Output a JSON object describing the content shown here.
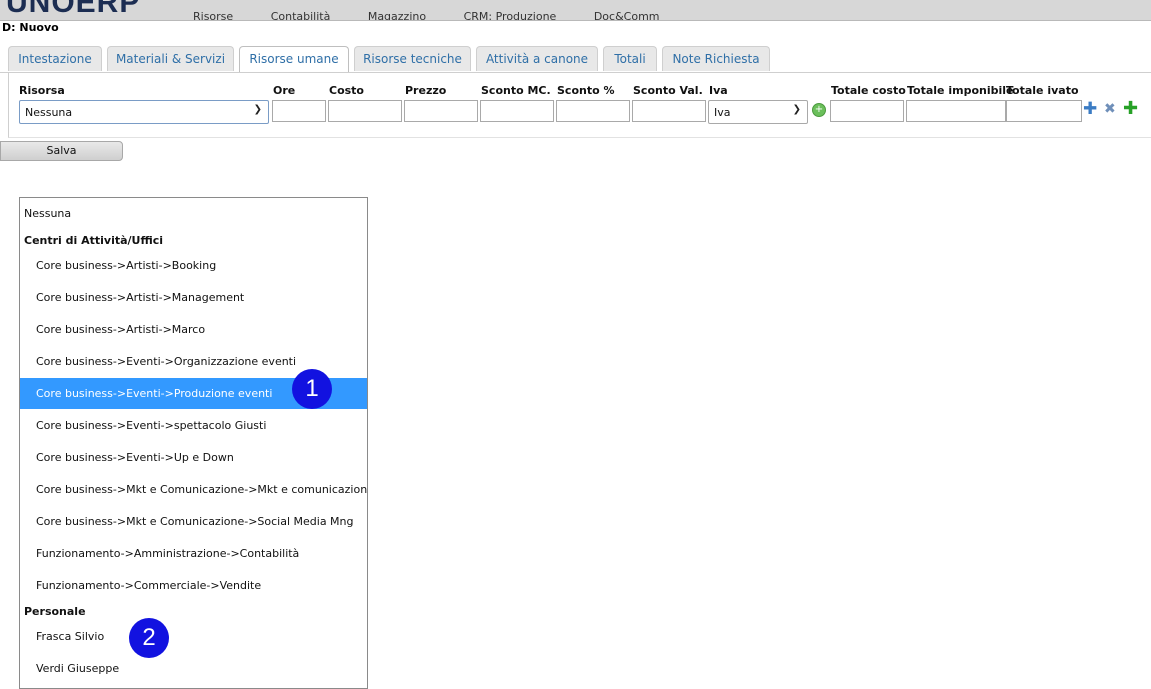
{
  "header": {
    "logo": "UNOERP",
    "nav": [
      "Risorse",
      "Contabilità",
      "Magazzino",
      "CRM: Produzione",
      "Doc&Comm"
    ],
    "doc_id": "D: Nuovo"
  },
  "tabs": [
    {
      "label": "Intestazione"
    },
    {
      "label": "Materiali & Servizi"
    },
    {
      "label": "Risorse umane",
      "active": true
    },
    {
      "label": "Risorse tecniche"
    },
    {
      "label": "Attività a canone"
    },
    {
      "label": "Totali"
    },
    {
      "label": "Note Richiesta"
    }
  ],
  "form": {
    "labels": {
      "risorsa": "Risorsa",
      "ore": "Ore",
      "costo": "Costo",
      "prezzo": "Prezzo",
      "sconto_mc": "Sconto MC.",
      "sconto_pct": "Sconto %",
      "sconto_val": "Sconto Val.",
      "iva": "Iva",
      "totale_costo": "Totale costo",
      "totale_imponibile": "Totale imponibile",
      "totale_ivato": "Totale ivato"
    },
    "risorsa_value": "Nessuna",
    "iva_value": "Iva",
    "add_symbol": "+",
    "icons": {
      "add_row": "plus-icon",
      "delete_row": "x-icon",
      "new_row": "plus-icon"
    },
    "save_label": "Salva"
  },
  "dropdown": {
    "first_option": "Nessuna",
    "groups": [
      {
        "label": "Centri di Attività/Uffici",
        "options": [
          "Core business->Artisti->Booking",
          "Core business->Artisti->Management",
          "Core business->Artisti->Marco",
          "Core business->Eventi->Organizzazione eventi",
          "Core business->Eventi->Produzione eventi",
          "Core business->Eventi->spettacolo Giusti",
          "Core business->Eventi->Up e Down",
          "Core business->Mkt e Comunicazione->Mkt e comunicazione",
          "Core business->Mkt e Comunicazione->Social Media Mng",
          "Funzionamento->Amministrazione->Contabilità",
          "Funzionamento->Commerciale->Vendite"
        ]
      },
      {
        "label": "Personale",
        "options": [
          "Frasca Silvio",
          "Verdi Giuseppe"
        ]
      }
    ],
    "selected_option": "Core business->Eventi->Produzione eventi"
  },
  "markers": [
    "1",
    "2"
  ],
  "colors": {
    "selected": "#3399ff",
    "marker": "#1212e0",
    "tab_text": "#2f6fa7"
  }
}
